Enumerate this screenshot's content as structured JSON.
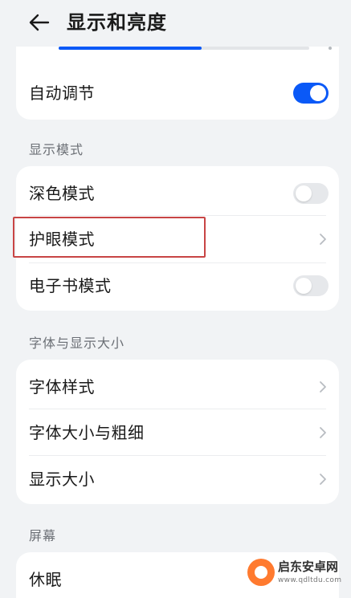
{
  "header": {
    "title": "显示和亮度",
    "back_icon": "back-arrow-icon"
  },
  "brightness": {
    "level": 0.57,
    "auto_label": "自动调节",
    "auto_enabled": true
  },
  "sections": {
    "display_mode": {
      "title": "显示模式",
      "dark_mode": {
        "label": "深色模式",
        "enabled": false
      },
      "eye_comfort": {
        "label": "护眼模式"
      },
      "ebook_mode": {
        "label": "电子书模式",
        "enabled": false
      }
    },
    "font_display": {
      "title": "字体与显示大小",
      "font_style": {
        "label": "字体样式"
      },
      "font_size_weight": {
        "label": "字体大小与粗细"
      },
      "display_size": {
        "label": "显示大小"
      }
    },
    "screen": {
      "title": "屏幕",
      "sleep": {
        "label": "休眠"
      }
    }
  },
  "watermark": {
    "name": "启东安卓网",
    "url": "www.qdltdu.com"
  },
  "colors": {
    "accent": "#0a59f7",
    "background": "#f1f3f5",
    "card": "#ffffff",
    "highlight_border": "#c84545"
  }
}
